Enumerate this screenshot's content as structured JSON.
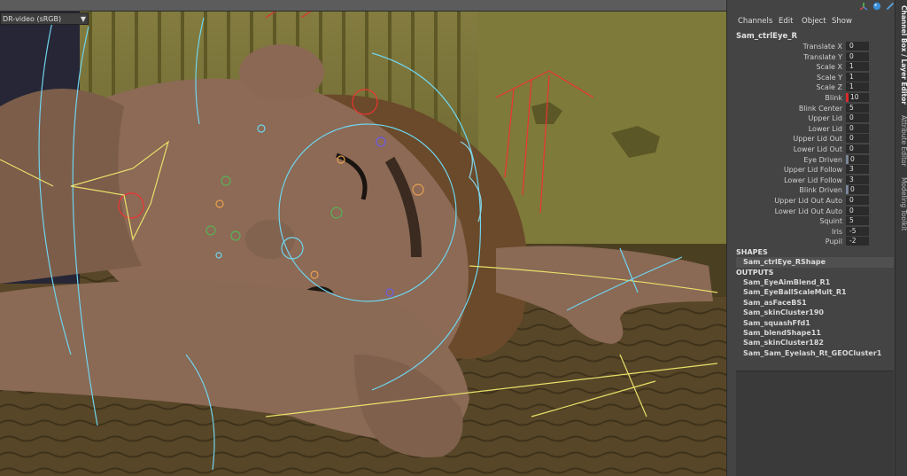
{
  "viewport": {
    "colorspace_label": "DR-video (sRGB)",
    "dropdown_icon": "chevron-down-icon"
  },
  "header": {
    "menus": [
      "Channels",
      "Edit",
      "Object",
      "Show"
    ],
    "icons": [
      "axis-tripod-icon",
      "sphere-icon",
      "edit-pencil-icon"
    ]
  },
  "channel_box": {
    "node_name": "Sam_ctrlEye_R",
    "attributes": [
      {
        "label": "Translate X",
        "value": "0"
      },
      {
        "label": "Translate Y",
        "value": "0"
      },
      {
        "label": "Scale X",
        "value": "1"
      },
      {
        "label": "Scale Y",
        "value": "1"
      },
      {
        "label": "Scale Z",
        "value": "1"
      },
      {
        "label": "Blink",
        "value": "10",
        "state": "keyed"
      },
      {
        "label": "Blink Center",
        "value": "5"
      },
      {
        "label": "Upper Lid",
        "value": "0"
      },
      {
        "label": "Lower Lid",
        "value": "0"
      },
      {
        "label": "Upper Lid Out",
        "value": "0"
      },
      {
        "label": "Lower Lid Out",
        "value": "0"
      },
      {
        "label": "Eye Driven",
        "value": "0",
        "state": "driven"
      },
      {
        "label": "Upper Lid Follow",
        "value": "3"
      },
      {
        "label": "Lower Lid Follow",
        "value": "3"
      },
      {
        "label": "Blink Driven",
        "value": "0",
        "state": "driven"
      },
      {
        "label": "Upper Lid Out Auto",
        "value": "0"
      },
      {
        "label": "Lower Lid Out Auto",
        "value": "0"
      },
      {
        "label": "Squint",
        "value": "5"
      },
      {
        "label": "Iris",
        "value": "-5"
      },
      {
        "label": "Pupil",
        "value": "-2"
      }
    ],
    "shapes_header": "SHAPES",
    "shape_node": "Sam_ctrlEye_RShape",
    "outputs_header": "OUTPUTS",
    "outputs": [
      "Sam_EyeAimBlend_R1",
      "Sam_EyeBallScaleMult_R1",
      "Sam_asFaceBS1",
      "Sam_skinCluster190",
      "Sam_squashFfd1",
      "Sam_blendShape11",
      "Sam_skinCluster182",
      "Sam_Sam_Eyelash_Rt_GEOCluster1"
    ],
    "colors": {
      "keyed": "#d82a2a",
      "driven": "#7a8599",
      "panel": "#444444"
    }
  },
  "side_tabs": [
    "Channel Box / Layer Editor",
    "Attribute Editor",
    "Modeling Toolkit"
  ]
}
